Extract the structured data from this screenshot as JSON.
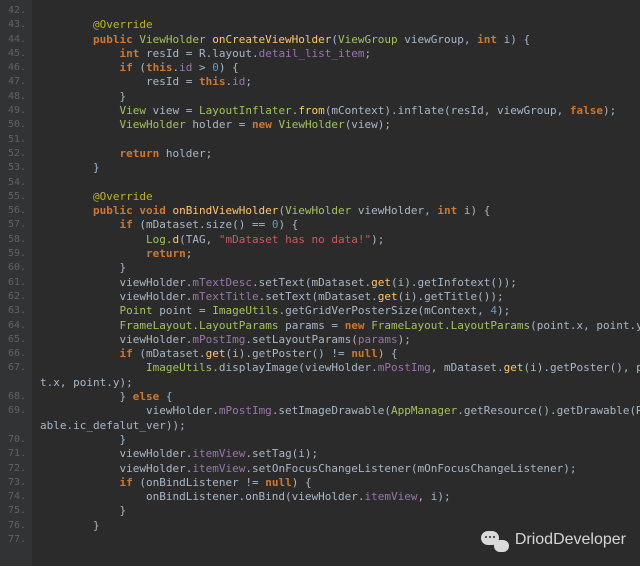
{
  "gutter_start": 42,
  "gutter_end": 77,
  "watermark": "DriodDeveloper",
  "code_lines": [
    {
      "n": 42,
      "ind": 2,
      "seg": []
    },
    {
      "n": 43,
      "ind": 2,
      "seg": [
        {
          "c": "an",
          "t": "@Override"
        }
      ]
    },
    {
      "n": 44,
      "ind": 2,
      "seg": [
        {
          "c": "k",
          "t": "public "
        },
        {
          "c": "ty",
          "t": "ViewHolder "
        },
        {
          "c": "fn",
          "t": "onCreateViewHolder"
        },
        {
          "c": "tx",
          "t": "("
        },
        {
          "c": "ty",
          "t": "ViewGroup"
        },
        {
          "c": "tx",
          "t": " viewGroup, "
        },
        {
          "c": "k",
          "t": "int"
        },
        {
          "c": "tx",
          "t": " i) {"
        }
      ]
    },
    {
      "n": 45,
      "ind": 3,
      "seg": [
        {
          "c": "k",
          "t": "int"
        },
        {
          "c": "tx",
          "t": " resId = R.layout."
        },
        {
          "c": "fd",
          "t": "detail_list_item"
        },
        {
          "c": "tx",
          "t": ";"
        }
      ]
    },
    {
      "n": 46,
      "ind": 3,
      "seg": [
        {
          "c": "k",
          "t": "if "
        },
        {
          "c": "tx",
          "t": "("
        },
        {
          "c": "k",
          "t": "this"
        },
        {
          "c": "tx",
          "t": "."
        },
        {
          "c": "fd",
          "t": "id"
        },
        {
          "c": "tx",
          "t": " > "
        },
        {
          "c": "nm",
          "t": "0"
        },
        {
          "c": "tx",
          "t": ") {"
        }
      ]
    },
    {
      "n": 47,
      "ind": 4,
      "seg": [
        {
          "c": "tx",
          "t": "resId = "
        },
        {
          "c": "k",
          "t": "this"
        },
        {
          "c": "tx",
          "t": "."
        },
        {
          "c": "fd",
          "t": "id"
        },
        {
          "c": "tx",
          "t": ";"
        }
      ]
    },
    {
      "n": 48,
      "ind": 3,
      "seg": [
        {
          "c": "tx",
          "t": "}"
        }
      ]
    },
    {
      "n": 49,
      "ind": 3,
      "seg": [
        {
          "c": "ty",
          "t": "View"
        },
        {
          "c": "tx",
          "t": " view = "
        },
        {
          "c": "ty",
          "t": "LayoutInflater"
        },
        {
          "c": "tx",
          "t": "."
        },
        {
          "c": "fn",
          "t": "from"
        },
        {
          "c": "tx",
          "t": "(mContext).inflate(resId, viewGroup, "
        },
        {
          "c": "k",
          "t": "false"
        },
        {
          "c": "tx",
          "t": ");"
        }
      ]
    },
    {
      "n": 50,
      "ind": 3,
      "seg": [
        {
          "c": "ty",
          "t": "ViewHolder"
        },
        {
          "c": "tx",
          "t": " holder = "
        },
        {
          "c": "k",
          "t": "new "
        },
        {
          "c": "ty",
          "t": "ViewHolder"
        },
        {
          "c": "tx",
          "t": "(view);"
        }
      ]
    },
    {
      "n": 51,
      "ind": 3,
      "seg": []
    },
    {
      "n": 52,
      "ind": 3,
      "seg": [
        {
          "c": "k",
          "t": "return "
        },
        {
          "c": "tx",
          "t": "holder;"
        }
      ]
    },
    {
      "n": 53,
      "ind": 2,
      "seg": [
        {
          "c": "tx",
          "t": "}"
        }
      ]
    },
    {
      "n": 54,
      "ind": 2,
      "seg": []
    },
    {
      "n": 55,
      "ind": 2,
      "seg": [
        {
          "c": "an",
          "t": "@Override"
        }
      ]
    },
    {
      "n": 56,
      "ind": 2,
      "seg": [
        {
          "c": "k",
          "t": "public void "
        },
        {
          "c": "fn",
          "t": "onBindViewHolder"
        },
        {
          "c": "tx",
          "t": "("
        },
        {
          "c": "ty",
          "t": "ViewHolder"
        },
        {
          "c": "tx",
          "t": " viewHolder, "
        },
        {
          "c": "k",
          "t": "int"
        },
        {
          "c": "tx",
          "t": " i) {"
        }
      ]
    },
    {
      "n": 57,
      "ind": 3,
      "seg": [
        {
          "c": "k",
          "t": "if "
        },
        {
          "c": "tx",
          "t": "(mDataset.size() == "
        },
        {
          "c": "nm",
          "t": "0"
        },
        {
          "c": "tx",
          "t": ") {"
        }
      ]
    },
    {
      "n": 58,
      "ind": 4,
      "seg": [
        {
          "c": "ty",
          "t": "Log"
        },
        {
          "c": "tx",
          "t": "."
        },
        {
          "c": "fn",
          "t": "d"
        },
        {
          "c": "tx",
          "t": "(TAG, "
        },
        {
          "c": "stR",
          "t": "\"mDataset has no data!\""
        },
        {
          "c": "tx",
          "t": ");"
        }
      ]
    },
    {
      "n": 59,
      "ind": 4,
      "seg": [
        {
          "c": "k",
          "t": "return"
        },
        {
          "c": "tx",
          "t": ";"
        }
      ]
    },
    {
      "n": 60,
      "ind": 3,
      "seg": [
        {
          "c": "tx",
          "t": "}"
        }
      ]
    },
    {
      "n": 61,
      "ind": 3,
      "seg": [
        {
          "c": "tx",
          "t": "viewHolder."
        },
        {
          "c": "fd",
          "t": "mTextDesc"
        },
        {
          "c": "tx",
          "t": ".setText(mDataset."
        },
        {
          "c": "fn",
          "t": "get"
        },
        {
          "c": "tx",
          "t": "(i).getInfotext());"
        }
      ]
    },
    {
      "n": 62,
      "ind": 3,
      "seg": [
        {
          "c": "tx",
          "t": "viewHolder."
        },
        {
          "c": "fd",
          "t": "mTextTitle"
        },
        {
          "c": "tx",
          "t": ".setText(mDataset."
        },
        {
          "c": "fn",
          "t": "get"
        },
        {
          "c": "tx",
          "t": "(i).getTitle());"
        }
      ]
    },
    {
      "n": 63,
      "ind": 3,
      "seg": [
        {
          "c": "ty",
          "t": "Point"
        },
        {
          "c": "tx",
          "t": " point = "
        },
        {
          "c": "ty",
          "t": "ImageUtils"
        },
        {
          "c": "tx",
          "t": ".getGridVerPosterSize(mContext, "
        },
        {
          "c": "nm",
          "t": "4"
        },
        {
          "c": "tx",
          "t": ");"
        }
      ]
    },
    {
      "n": 64,
      "ind": 3,
      "seg": [
        {
          "c": "ty",
          "t": "FrameLayout"
        },
        {
          "c": "tx",
          "t": "."
        },
        {
          "c": "ty",
          "t": "LayoutParams"
        },
        {
          "c": "tx",
          "t": " params = "
        },
        {
          "c": "k",
          "t": "new "
        },
        {
          "c": "ty",
          "t": "FrameLayout"
        },
        {
          "c": "tx",
          "t": "."
        },
        {
          "c": "ty",
          "t": "LayoutParams"
        },
        {
          "c": "tx",
          "t": "(point.x, point.y);"
        }
      ]
    },
    {
      "n": 65,
      "ind": 3,
      "seg": [
        {
          "c": "tx",
          "t": "viewHolder."
        },
        {
          "c": "fd",
          "t": "mPostImg"
        },
        {
          "c": "tx",
          "t": ".setLayoutParams("
        },
        {
          "c": "fd",
          "t": "params"
        },
        {
          "c": "tx",
          "t": ");"
        }
      ]
    },
    {
      "n": 66,
      "ind": 3,
      "seg": [
        {
          "c": "k",
          "t": "if "
        },
        {
          "c": "tx",
          "t": "(mDataset."
        },
        {
          "c": "fn",
          "t": "get"
        },
        {
          "c": "tx",
          "t": "(i).getPoster() != "
        },
        {
          "c": "k",
          "t": "null"
        },
        {
          "c": "tx",
          "t": ") {"
        }
      ]
    },
    {
      "n": 67,
      "ind": 4,
      "wrap": true,
      "seg": [
        {
          "c": "ty",
          "t": "ImageUtils"
        },
        {
          "c": "tx",
          "t": ".displayImage(viewHolder."
        },
        {
          "c": "fd",
          "t": "mPostImg"
        },
        {
          "c": "tx",
          "t": ", mDataset."
        },
        {
          "c": "fn",
          "t": "get"
        },
        {
          "c": "tx",
          "t": "(i).getPoster(), poin"
        }
      ],
      "wrap_text": "t.x, point.y);"
    },
    {
      "n": 68,
      "ind": 3,
      "seg": [
        {
          "c": "tx",
          "t": "} "
        },
        {
          "c": "k",
          "t": "else "
        },
        {
          "c": "tx",
          "t": "{"
        }
      ]
    },
    {
      "n": 69,
      "ind": 4,
      "wrap": true,
      "seg": [
        {
          "c": "tx",
          "t": "viewHolder."
        },
        {
          "c": "fd",
          "t": "mPostImg"
        },
        {
          "c": "tx",
          "t": ".setImageDrawable("
        },
        {
          "c": "ty",
          "t": "AppManager"
        },
        {
          "c": "tx",
          "t": ".getResource().getDrawable(R.draw"
        }
      ],
      "wrap_text": "able.ic_defalut_ver));"
    },
    {
      "n": 70,
      "ind": 3,
      "seg": [
        {
          "c": "tx",
          "t": "}"
        }
      ]
    },
    {
      "n": 71,
      "ind": 3,
      "seg": [
        {
          "c": "tx",
          "t": "viewHolder."
        },
        {
          "c": "fd",
          "t": "itemView"
        },
        {
          "c": "tx",
          "t": ".setTag(i);"
        }
      ]
    },
    {
      "n": 72,
      "ind": 3,
      "seg": [
        {
          "c": "tx",
          "t": "viewHolder."
        },
        {
          "c": "fd",
          "t": "itemView"
        },
        {
          "c": "tx",
          "t": ".setOnFocusChangeListener(mOnFocusChangeListener);"
        }
      ]
    },
    {
      "n": 73,
      "ind": 3,
      "seg": [
        {
          "c": "k",
          "t": "if "
        },
        {
          "c": "tx",
          "t": "(onBindListener != "
        },
        {
          "c": "k",
          "t": "null"
        },
        {
          "c": "tx",
          "t": ") {"
        }
      ]
    },
    {
      "n": 74,
      "ind": 4,
      "seg": [
        {
          "c": "tx",
          "t": "onBindListener.onBind(viewHolder."
        },
        {
          "c": "fd",
          "t": "itemView"
        },
        {
          "c": "tx",
          "t": ", i);"
        }
      ]
    },
    {
      "n": 75,
      "ind": 3,
      "seg": [
        {
          "c": "tx",
          "t": "}"
        }
      ]
    },
    {
      "n": 76,
      "ind": 2,
      "seg": [
        {
          "c": "tx",
          "t": "}"
        }
      ]
    },
    {
      "n": 77,
      "ind": 2,
      "seg": []
    }
  ]
}
